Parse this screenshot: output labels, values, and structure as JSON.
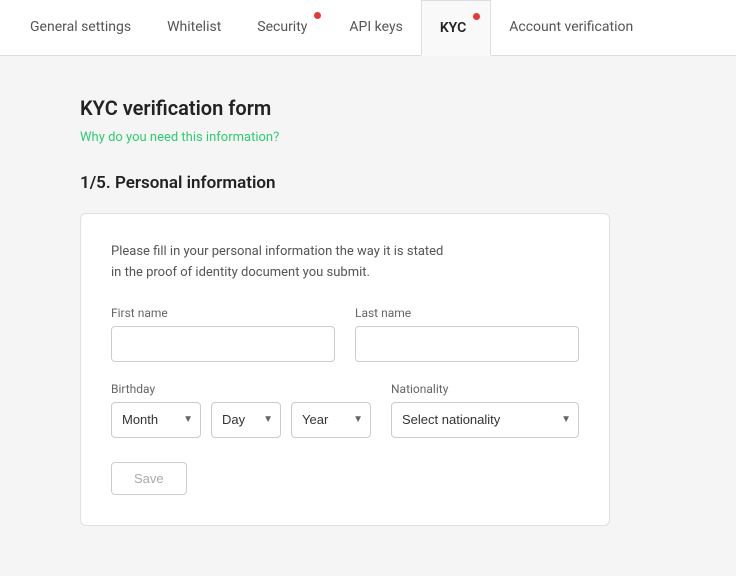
{
  "tabs": [
    {
      "id": "general-settings",
      "label": "General settings",
      "active": false,
      "dot": false
    },
    {
      "id": "whitelist",
      "label": "Whitelist",
      "active": false,
      "dot": false
    },
    {
      "id": "security",
      "label": "Security",
      "active": false,
      "dot": true
    },
    {
      "id": "api-keys",
      "label": "API keys",
      "active": false,
      "dot": false
    },
    {
      "id": "kyc",
      "label": "KYC",
      "active": true,
      "dot": true
    },
    {
      "id": "account-verification",
      "label": "Account verification",
      "active": false,
      "dot": false
    }
  ],
  "page": {
    "form_title": "KYC verification form",
    "form_link": "Why do you need this information?",
    "step_title": "1/5. Personal information",
    "instruction_line1": "Please fill in your personal information the way it is stated",
    "instruction_line2": "in the proof of identity document you submit.",
    "first_name_label": "First name",
    "last_name_label": "Last name",
    "birthday_label": "Birthday",
    "nationality_label": "Nationality",
    "month_placeholder": "Month",
    "day_placeholder": "Day",
    "year_placeholder": "Year",
    "nationality_placeholder": "Select nationality",
    "save_label": "Save"
  }
}
